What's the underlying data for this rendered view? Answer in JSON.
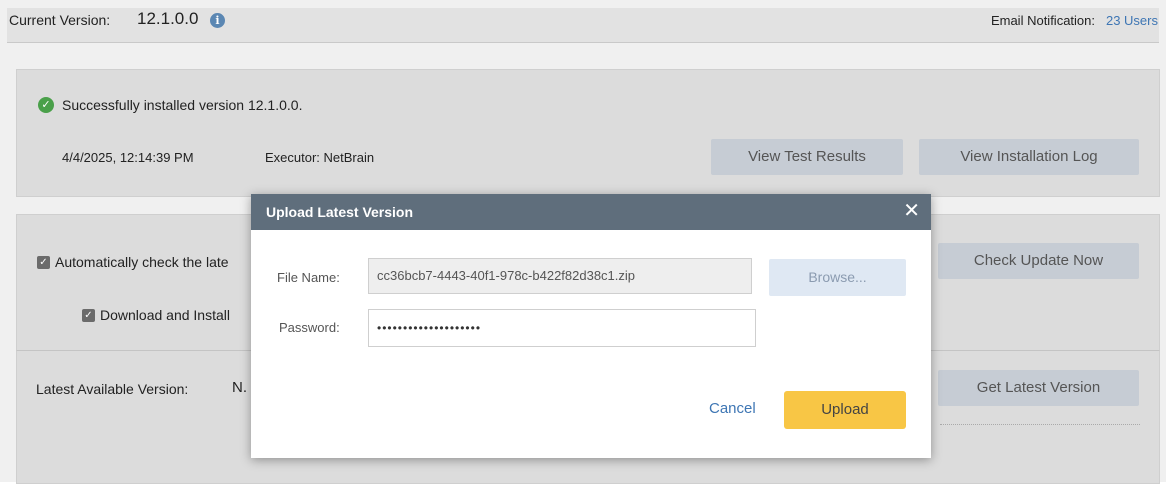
{
  "header": {
    "current_version_label": "Current Version:",
    "current_version": "12.1.0.0",
    "email_label": "Email Notification:",
    "email_link": "23 Users"
  },
  "status": {
    "message": "Successfully installed version 12.1.0.0.",
    "datetime": "4/4/2025, 12:14:39 PM",
    "executor": "Executor: NetBrain",
    "view_test_results": "View Test Results",
    "view_installation_log": "View Installation Log"
  },
  "update_settings": {
    "auto_check_label": "Automatically check the late",
    "download_install_label": "Download and Install",
    "check_update_now": "Check Update Now"
  },
  "latest": {
    "label": "Latest Available Version:",
    "value": "N.",
    "get_latest_version": "Get Latest Version"
  },
  "dialog": {
    "title": "Upload Latest Version",
    "close_glyph": "✕",
    "file_name_label": "File Name:",
    "file_name_value": "cc36bcb7-4443-40f1-978c-b422f82d38c1.zip",
    "password_label": "Password:",
    "password_value": "••••••••••••••••••••",
    "browse": "Browse...",
    "cancel": "Cancel",
    "upload": "Upload"
  },
  "icons": {
    "info": "info-icon",
    "success": "check-circle-icon",
    "checkbox": "checkbox-checked-icon",
    "close": "close-icon"
  },
  "colors": {
    "link": "#3e76b4",
    "dialog_header": "#5f6e7c",
    "upload_button": "#f8c645",
    "success": "#4aa04a"
  }
}
